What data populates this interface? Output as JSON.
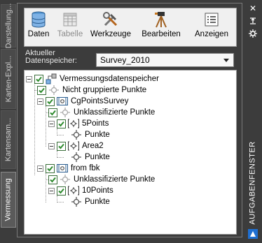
{
  "side_tabs": [
    {
      "label": "Darstellung..."
    },
    {
      "label": "Karten-Expl..."
    },
    {
      "label": "Kartensam..."
    },
    {
      "label": "Vermessung"
    }
  ],
  "toolbar": {
    "daten": "Daten",
    "tabelle": "Tabelle",
    "werkzeuge": "Werkzeuge",
    "bearbeiten": "Bearbeiten",
    "anzeigen": "Anzeigen"
  },
  "datastore": {
    "label_line1": "Aktueller",
    "label_line2": "Datenspeicher:",
    "selected": "Survey_2010"
  },
  "tree": {
    "root": "Vermessungsdatenspeicher",
    "n1": "Nicht gruppierte Punkte",
    "n2": "CgPointsSurvey",
    "n2a": "Unklassifizierte Punkte",
    "n2b": "5Points",
    "n2b1": "Punkte",
    "n2c": "Area2",
    "n2c1": "Punkte",
    "n3": "from fbk",
    "n3a": "Unklassifizierte Punkte",
    "n3b": "10Points",
    "n3b1": "Punkte"
  },
  "right_panel": {
    "title": "AUFGABENFENSTER",
    "close": "✕"
  },
  "colors": {
    "background": "#3c3c3c",
    "check_green": "#2e8b2e",
    "point_icon": "#555555",
    "toolbar_bg": "#f0f0f0"
  }
}
